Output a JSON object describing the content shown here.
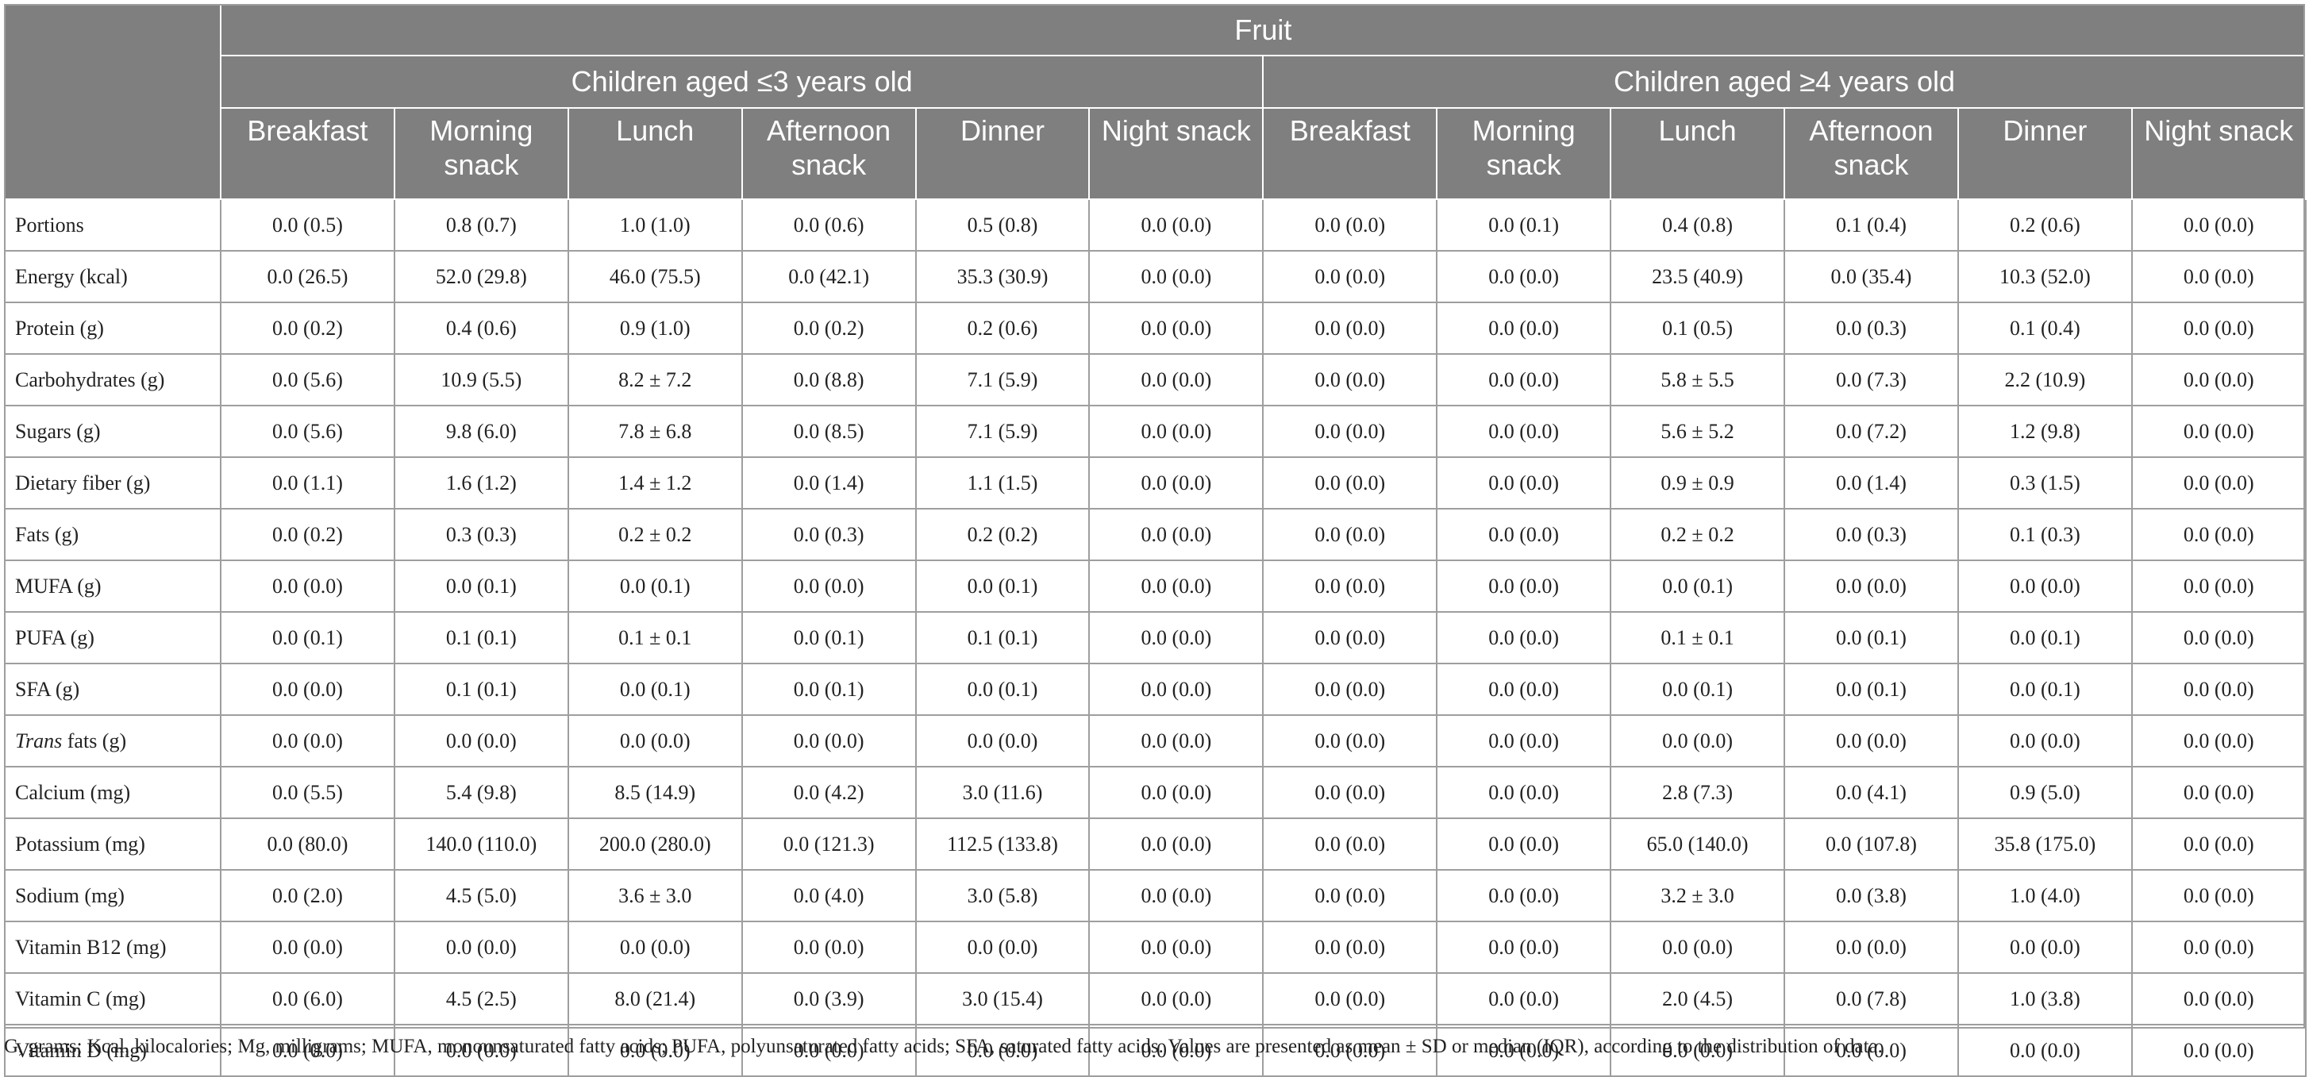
{
  "header": {
    "group": "Fruit",
    "age_groups": [
      "Children aged ≤3 years old",
      "Children aged ≥4 years old"
    ],
    "meals": [
      "Breakfast",
      "Morning snack",
      "Lunch",
      "Afternoon snack",
      "Dinner",
      "Night snack"
    ]
  },
  "rows": [
    {
      "label": "Portions",
      "values": [
        "0.0 (0.5)",
        "0.8 (0.7)",
        "1.0 (1.0)",
        "0.0 (0.6)",
        "0.5 (0.8)",
        "0.0 (0.0)",
        "0.0 (0.0)",
        "0.0 (0.1)",
        "0.4 (0.8)",
        "0.1 (0.4)",
        "0.2 (0.6)",
        "0.0 (0.0)"
      ]
    },
    {
      "label": "Energy (kcal)",
      "values": [
        "0.0 (26.5)",
        "52.0 (29.8)",
        "46.0 (75.5)",
        "0.0 (42.1)",
        "35.3 (30.9)",
        "0.0 (0.0)",
        "0.0 (0.0)",
        "0.0 (0.0)",
        "23.5 (40.9)",
        "0.0 (35.4)",
        "10.3 (52.0)",
        "0.0 (0.0)"
      ]
    },
    {
      "label": "Protein (g)",
      "values": [
        "0.0 (0.2)",
        "0.4 (0.6)",
        "0.9 (1.0)",
        "0.0 (0.2)",
        "0.2 (0.6)",
        "0.0 (0.0)",
        "0.0 (0.0)",
        "0.0 (0.0)",
        "0.1 (0.5)",
        "0.0 (0.3)",
        "0.1 (0.4)",
        "0.0 (0.0)"
      ]
    },
    {
      "label": "Carbohydrates (g)",
      "values": [
        "0.0 (5.6)",
        "10.9 (5.5)",
        "8.2 ± 7.2",
        "0.0 (8.8)",
        "7.1 (5.9)",
        "0.0 (0.0)",
        "0.0 (0.0)",
        "0.0 (0.0)",
        "5.8 ± 5.5",
        "0.0 (7.3)",
        "2.2 (10.9)",
        "0.0 (0.0)"
      ]
    },
    {
      "label": "Sugars (g)",
      "values": [
        "0.0 (5.6)",
        "9.8 (6.0)",
        "7.8 ± 6.8",
        "0.0 (8.5)",
        "7.1 (5.9)",
        "0.0 (0.0)",
        "0.0 (0.0)",
        "0.0 (0.0)",
        "5.6 ± 5.2",
        "0.0 (7.2)",
        "1.2 (9.8)",
        "0.0 (0.0)"
      ]
    },
    {
      "label": "Dietary fiber (g)",
      "values": [
        "0.0 (1.1)",
        "1.6 (1.2)",
        "1.4 ± 1.2",
        "0.0 (1.4)",
        "1.1 (1.5)",
        "0.0 (0.0)",
        "0.0 (0.0)",
        "0.0 (0.0)",
        "0.9 ± 0.9",
        "0.0 (1.4)",
        "0.3 (1.5)",
        "0.0 (0.0)"
      ]
    },
    {
      "label": "Fats (g)",
      "values": [
        "0.0 (0.2)",
        "0.3 (0.3)",
        "0.2 ± 0.2",
        "0.0 (0.3)",
        "0.2 (0.2)",
        "0.0 (0.0)",
        "0.0 (0.0)",
        "0.0 (0.0)",
        "0.2 ± 0.2",
        "0.0 (0.3)",
        "0.1 (0.3)",
        "0.0 (0.0)"
      ]
    },
    {
      "label": "MUFA (g)",
      "values": [
        "0.0 (0.0)",
        "0.0 (0.1)",
        "0.0 (0.1)",
        "0.0 (0.0)",
        "0.0 (0.1)",
        "0.0 (0.0)",
        "0.0 (0.0)",
        "0.0 (0.0)",
        "0.0 (0.1)",
        "0.0 (0.0)",
        "0.0 (0.0)",
        "0.0 (0.0)"
      ]
    },
    {
      "label": "PUFA (g)",
      "values": [
        "0.0 (0.1)",
        "0.1 (0.1)",
        "0.1 ± 0.1",
        "0.0 (0.1)",
        "0.1 (0.1)",
        "0.0 (0.0)",
        "0.0 (0.0)",
        "0.0 (0.0)",
        "0.1 ± 0.1",
        "0.0 (0.1)",
        "0.0 (0.1)",
        "0.0 (0.0)"
      ]
    },
    {
      "label": "SFA (g)",
      "values": [
        "0.0 (0.0)",
        "0.1 (0.1)",
        "0.0 (0.1)",
        "0.0 (0.1)",
        "0.0 (0.1)",
        "0.0 (0.0)",
        "0.0 (0.0)",
        "0.0 (0.0)",
        "0.0 (0.1)",
        "0.0 (0.1)",
        "0.0 (0.1)",
        "0.0 (0.0)"
      ]
    },
    {
      "label_italic": "Trans",
      "label": " fats (g)",
      "values": [
        "0.0 (0.0)",
        "0.0 (0.0)",
        "0.0 (0.0)",
        "0.0 (0.0)",
        "0.0 (0.0)",
        "0.0 (0.0)",
        "0.0 (0.0)",
        "0.0 (0.0)",
        "0.0 (0.0)",
        "0.0 (0.0)",
        "0.0 (0.0)",
        "0.0 (0.0)"
      ]
    },
    {
      "label": "Calcium (mg)",
      "values": [
        "0.0 (5.5)",
        "5.4 (9.8)",
        "8.5 (14.9)",
        "0.0 (4.2)",
        "3.0 (11.6)",
        "0.0 (0.0)",
        "0.0 (0.0)",
        "0.0 (0.0)",
        "2.8 (7.3)",
        "0.0 (4.1)",
        "0.9 (5.0)",
        "0.0 (0.0)"
      ]
    },
    {
      "label": "Potassium (mg)",
      "values": [
        "0.0 (80.0)",
        "140.0 (110.0)",
        "200.0 (280.0)",
        "0.0 (121.3)",
        "112.5 (133.8)",
        "0.0 (0.0)",
        "0.0 (0.0)",
        "0.0 (0.0)",
        "65.0 (140.0)",
        "0.0 (107.8)",
        "35.8 (175.0)",
        "0.0 (0.0)"
      ]
    },
    {
      "label": "Sodium (mg)",
      "values": [
        "0.0 (2.0)",
        "4.5 (5.0)",
        "3.6 ± 3.0",
        "0.0 (4.0)",
        "3.0 (5.8)",
        "0.0 (0.0)",
        "0.0 (0.0)",
        "0.0 (0.0)",
        "3.2 ± 3.0",
        "0.0 (3.8)",
        "1.0 (4.0)",
        "0.0 (0.0)"
      ]
    },
    {
      "label": "Vitamin B12 (mg)",
      "values": [
        "0.0 (0.0)",
        "0.0 (0.0)",
        "0.0 (0.0)",
        "0.0 (0.0)",
        "0.0 (0.0)",
        "0.0 (0.0)",
        "0.0 (0.0)",
        "0.0 (0.0)",
        "0.0 (0.0)",
        "0.0 (0.0)",
        "0.0 (0.0)",
        "0.0 (0.0)"
      ]
    },
    {
      "label": "Vitamin C (mg)",
      "values": [
        "0.0 (6.0)",
        "4.5 (2.5)",
        "8.0 (21.4)",
        "0.0 (3.9)",
        "3.0 (15.4)",
        "0.0 (0.0)",
        "0.0 (0.0)",
        "0.0 (0.0)",
        "2.0 (4.5)",
        "0.0 (7.8)",
        "1.0 (3.8)",
        "0.0 (0.0)"
      ]
    },
    {
      "label": "Vitamin D (mg)",
      "values": [
        "0.0 (0.0)",
        "0.0 (0.0)",
        "0.0 (0.0)",
        "0.0 (0.0)",
        "0.0 (0.0)",
        "0.0 (0.0)",
        "0.0 (0.0)",
        "0.0 (0.0)",
        "0.0 (0.0)",
        "0.0 (0.0)",
        "0.0 (0.0)",
        "0.0 (0.0)"
      ]
    }
  ],
  "footnote": "G, grams; Kcal, kilocalories; Mg, milligrams; MUFA, monounsaturated fatty acids; PUFA, polyunsaturated fatty acids; SFA, saturated fatty acids. Values are presented as mean ± SD or median (IQR), according to the distribution of data."
}
